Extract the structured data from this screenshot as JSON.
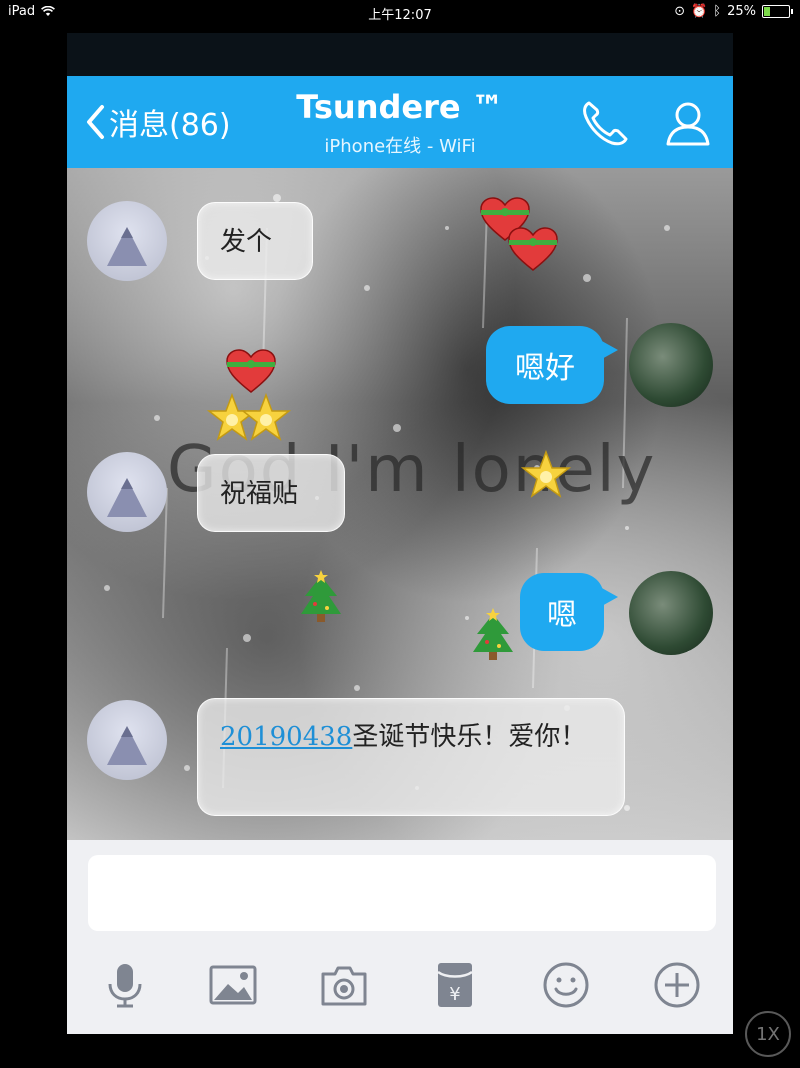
{
  "status_bar": {
    "device": "iPad",
    "time": "上午12:07",
    "battery": "25%",
    "battery_level": 0.25
  },
  "nav": {
    "back_label": "消息(86)",
    "title": "Tsundere ™",
    "subtitle": "iPhone在线 - WiFi",
    "phone_icon": "phone-icon",
    "profile_icon": "user-icon"
  },
  "chat": {
    "watermark": "God I'm lonely",
    "messages": [
      {
        "side": "left",
        "text": "发个"
      },
      {
        "side": "right",
        "text": "嗯好"
      },
      {
        "side": "left",
        "text": "祝福贴"
      },
      {
        "side": "right",
        "text": "嗯"
      },
      {
        "side": "left",
        "link": "20190438",
        "text": "圣诞节快乐！爱你！"
      }
    ],
    "decorations": [
      "gift-heart",
      "star",
      "christmas-tree"
    ]
  },
  "input": {
    "value": "",
    "placeholder": ""
  },
  "toolbar": [
    "mic-icon",
    "image-icon",
    "camera-icon",
    "red-packet-icon",
    "emoji-icon",
    "plus-icon"
  ],
  "overlay": {
    "zoom_label": "1X"
  },
  "colors": {
    "accent": "#1fa9f0",
    "link": "#1e8fd6",
    "input_bg": "#eff0f3"
  }
}
